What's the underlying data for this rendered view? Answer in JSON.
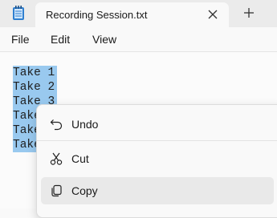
{
  "window": {
    "tab_title": "Recording Session.txt"
  },
  "menu": {
    "file": "File",
    "edit": "Edit",
    "view": "View"
  },
  "editor": {
    "lines": [
      "Take 1",
      "Take 2",
      "Take 3",
      "Take",
      "Take",
      "Take"
    ],
    "selection_color": "#99c9ef"
  },
  "context_menu": {
    "items": [
      {
        "label": "Undo",
        "icon": "undo-icon"
      },
      {
        "label": "Cut",
        "icon": "scissors-icon"
      },
      {
        "label": "Copy",
        "icon": "copy-icon",
        "highlighted": true
      }
    ]
  }
}
